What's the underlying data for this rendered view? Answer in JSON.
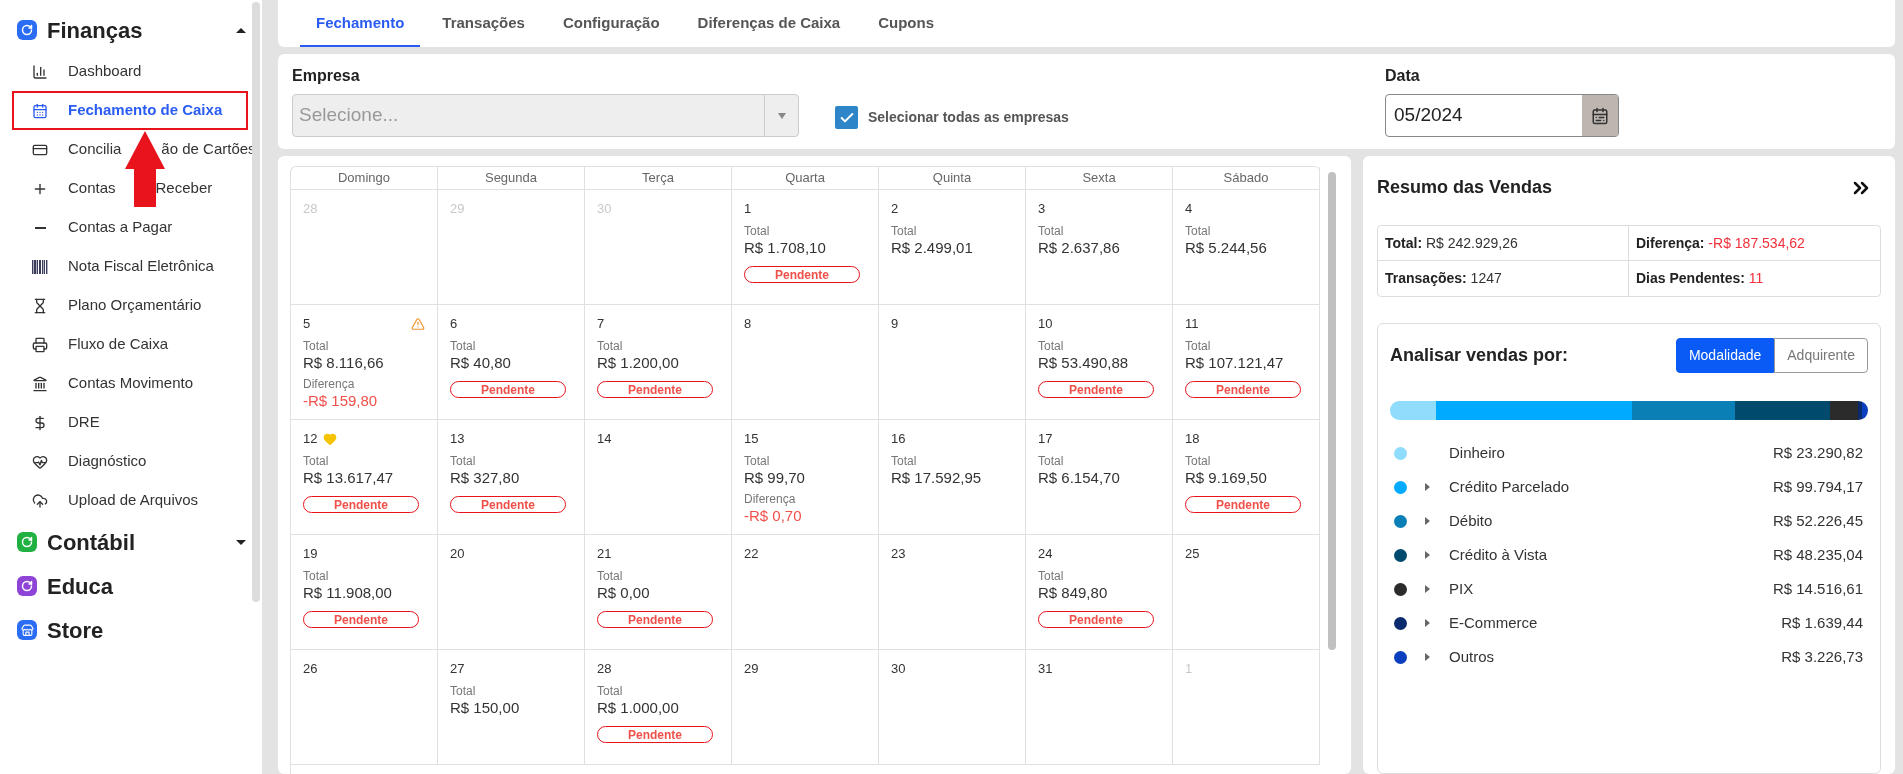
{
  "sidebar": {
    "sections": [
      {
        "title": "Finanças",
        "expanded": true,
        "items": [
          {
            "label": "Dashboard",
            "selected": false,
            "highlighted": false
          },
          {
            "label": "Fechamento de Caixa",
            "selected": true,
            "highlighted": true
          },
          {
            "label": [
              "Concilia",
              "ão de Cartões"
            ],
            "selected": false,
            "highlighted": false
          },
          {
            "label": [
              "Contas",
              "Receber"
            ],
            "selected": false,
            "highlighted": false
          },
          {
            "label": "Contas a Pagar",
            "selected": false,
            "highlighted": false
          },
          {
            "label": "Nota Fiscal Eletrônica",
            "selected": false,
            "highlighted": false
          },
          {
            "label": "Plano Orçamentário",
            "selected": false,
            "highlighted": false
          },
          {
            "label": "Fluxo de Caixa",
            "selected": false,
            "highlighted": false
          },
          {
            "label": "Contas Movimento",
            "selected": false,
            "highlighted": false
          },
          {
            "label": "DRE",
            "selected": false,
            "highlighted": false
          },
          {
            "label": "Diagnóstico",
            "selected": false,
            "highlighted": false
          },
          {
            "label": "Upload de Arquivos",
            "selected": false,
            "highlighted": false
          }
        ]
      },
      {
        "title": "Contábil",
        "expanded": false
      },
      {
        "title": "Educa"
      },
      {
        "title": "Store"
      }
    ]
  },
  "tabs": [
    {
      "label": "Fechamento",
      "selected": true
    },
    {
      "label": "Transações",
      "selected": false
    },
    {
      "label": "Configuração",
      "selected": false
    },
    {
      "label": "Diferenças de Caixa",
      "selected": false
    },
    {
      "label": "Cupons",
      "selected": false
    }
  ],
  "filters": {
    "company_label": "Empresa",
    "company_placeholder": "Selecione...",
    "company_disabled": true,
    "all_companies": {
      "label": "Selecionar todas as empresas",
      "checked": true
    },
    "date_label": "Data",
    "date_value": "05/2024"
  },
  "calendar": {
    "weekdays": [
      "Domingo",
      "Segunda",
      "Terça",
      "Quarta",
      "Quinta",
      "Sexta",
      "Sábado"
    ],
    "weeks": [
      [
        {
          "day": "28",
          "muted": true,
          "kind": "plain"
        },
        {
          "day": "29",
          "muted": true,
          "kind": "plain"
        },
        {
          "day": "30",
          "muted": true,
          "kind": "plain"
        },
        {
          "day": "1",
          "muted": false,
          "kind": "plain",
          "total_label": "Total",
          "total": "R$ 1.708,10",
          "status": "Pendente"
        },
        {
          "day": "2",
          "muted": false,
          "kind": "plain",
          "total_label": "Total",
          "total": "R$ 2.499,01"
        },
        {
          "day": "3",
          "muted": false,
          "kind": "plain",
          "total_label": "Total",
          "total": "R$ 2.637,86"
        },
        {
          "day": "4",
          "muted": false,
          "kind": "plain",
          "total_label": "Total",
          "total": "R$ 5.244,56"
        }
      ],
      [
        {
          "day": "5",
          "muted": false,
          "kind": "warning",
          "total_label": "Total",
          "total": "R$ 8.116,66",
          "diff_label": "Diferença",
          "diff": "-R$ 159,80"
        },
        {
          "day": "6",
          "muted": false,
          "kind": "plain",
          "total_label": "Total",
          "total": "R$ 40,80",
          "status": "Pendente"
        },
        {
          "day": "7",
          "muted": false,
          "kind": "plain",
          "total_label": "Total",
          "total": "R$ 1.200,00",
          "status": "Pendente"
        },
        {
          "day": "8",
          "muted": false,
          "kind": "plain"
        },
        {
          "day": "9",
          "muted": false,
          "kind": "plain"
        },
        {
          "day": "10",
          "muted": false,
          "kind": "plain",
          "total_label": "Total",
          "total": "R$ 53.490,88",
          "status": "Pendente"
        },
        {
          "day": "11",
          "muted": false,
          "kind": "plain",
          "total_label": "Total",
          "total": "R$ 107.121,47",
          "status": "Pendente"
        }
      ],
      [
        {
          "day": "12",
          "muted": false,
          "kind": "heart",
          "total_label": "Total",
          "total": "R$ 13.617,47",
          "status": "Pendente"
        },
        {
          "day": "13",
          "muted": false,
          "kind": "plain",
          "total_label": "Total",
          "total": "R$ 327,80",
          "status": "Pendente"
        },
        {
          "day": "14",
          "muted": false,
          "kind": "plain"
        },
        {
          "day": "15",
          "muted": false,
          "kind": "plain",
          "total_label": "Total",
          "total": "R$ 99,70",
          "diff_label": "Diferença",
          "diff": "-R$ 0,70"
        },
        {
          "day": "16",
          "muted": false,
          "kind": "plain",
          "total_label": "Total",
          "total": "R$ 17.592,95"
        },
        {
          "day": "17",
          "muted": false,
          "kind": "plain",
          "total_label": "Total",
          "total": "R$ 6.154,70"
        },
        {
          "day": "18",
          "muted": false,
          "kind": "plain",
          "total_label": "Total",
          "total": "R$ 9.169,50",
          "status": "Pendente"
        }
      ],
      [
        {
          "day": "19",
          "muted": false,
          "kind": "plain",
          "total_label": "Total",
          "total": "R$ 11.908,00",
          "status": "Pendente"
        },
        {
          "day": "20",
          "muted": false,
          "kind": "plain"
        },
        {
          "day": "21",
          "muted": false,
          "kind": "plain",
          "total_label": "Total",
          "total": "R$ 0,00",
          "status": "Pendente"
        },
        {
          "day": "22",
          "muted": false,
          "kind": "plain"
        },
        {
          "day": "23",
          "muted": false,
          "kind": "plain"
        },
        {
          "day": "24",
          "muted": false,
          "kind": "plain",
          "total_label": "Total",
          "total": "R$ 849,80",
          "status": "Pendente"
        },
        {
          "day": "25",
          "muted": false,
          "kind": "plain"
        }
      ],
      [
        {
          "day": "26",
          "muted": false,
          "kind": "plain"
        },
        {
          "day": "27",
          "muted": false,
          "kind": "plain",
          "total_label": "Total",
          "total": "R$ 150,00"
        },
        {
          "day": "28",
          "muted": false,
          "kind": "plain",
          "total_label": "Total",
          "total": "R$ 1.000,00",
          "status": "Pendente"
        },
        {
          "day": "29",
          "muted": false,
          "kind": "plain"
        },
        {
          "day": "30",
          "muted": false,
          "kind": "plain"
        },
        {
          "day": "31",
          "muted": false,
          "kind": "plain"
        },
        {
          "day": "1",
          "muted": true,
          "kind": "plain"
        }
      ]
    ]
  },
  "summary": {
    "title": "Resumo das Vendas",
    "stats": [
      {
        "label": "Total:",
        "value": "R$ 242.929,26",
        "alert": false
      },
      {
        "label": "Diferença:",
        "value": "-R$ 187.534,62",
        "alert": true
      },
      {
        "label": "Transações:",
        "value": "1247",
        "alert": false
      },
      {
        "label": "Dias Pendentes:",
        "value": "11",
        "alert": true
      }
    ],
    "analysis_title": "Analisar vendas por:",
    "modes": [
      {
        "label": "Modalidade",
        "selected": true
      },
      {
        "label": "Adquirente",
        "selected": false
      }
    ],
    "items": [
      {
        "name": "Dinheiro",
        "value": "R$ 23.290,82",
        "color": "#8fdcfc",
        "expandable": false
      },
      {
        "name": "Crédito Parcelado",
        "value": "R$ 99.794,17",
        "color": "#00aaff",
        "expandable": true
      },
      {
        "name": "Débito",
        "value": "R$ 52.226,45",
        "color": "#0a7fb5",
        "expandable": true
      },
      {
        "name": "Crédito à Vista",
        "value": "R$ 48.235,04",
        "color": "#004a6e",
        "expandable": true
      },
      {
        "name": "PIX",
        "value": "R$ 14.516,61",
        "color": "#2b2b2b",
        "expandable": true
      },
      {
        "name": "E-Commerce",
        "value": "R$ 1.639,44",
        "color": "#0a2a6e",
        "expandable": true
      },
      {
        "name": "Outros",
        "value": "R$ 3.226,73",
        "color": "#0a3fbf",
        "expandable": true
      }
    ]
  }
}
